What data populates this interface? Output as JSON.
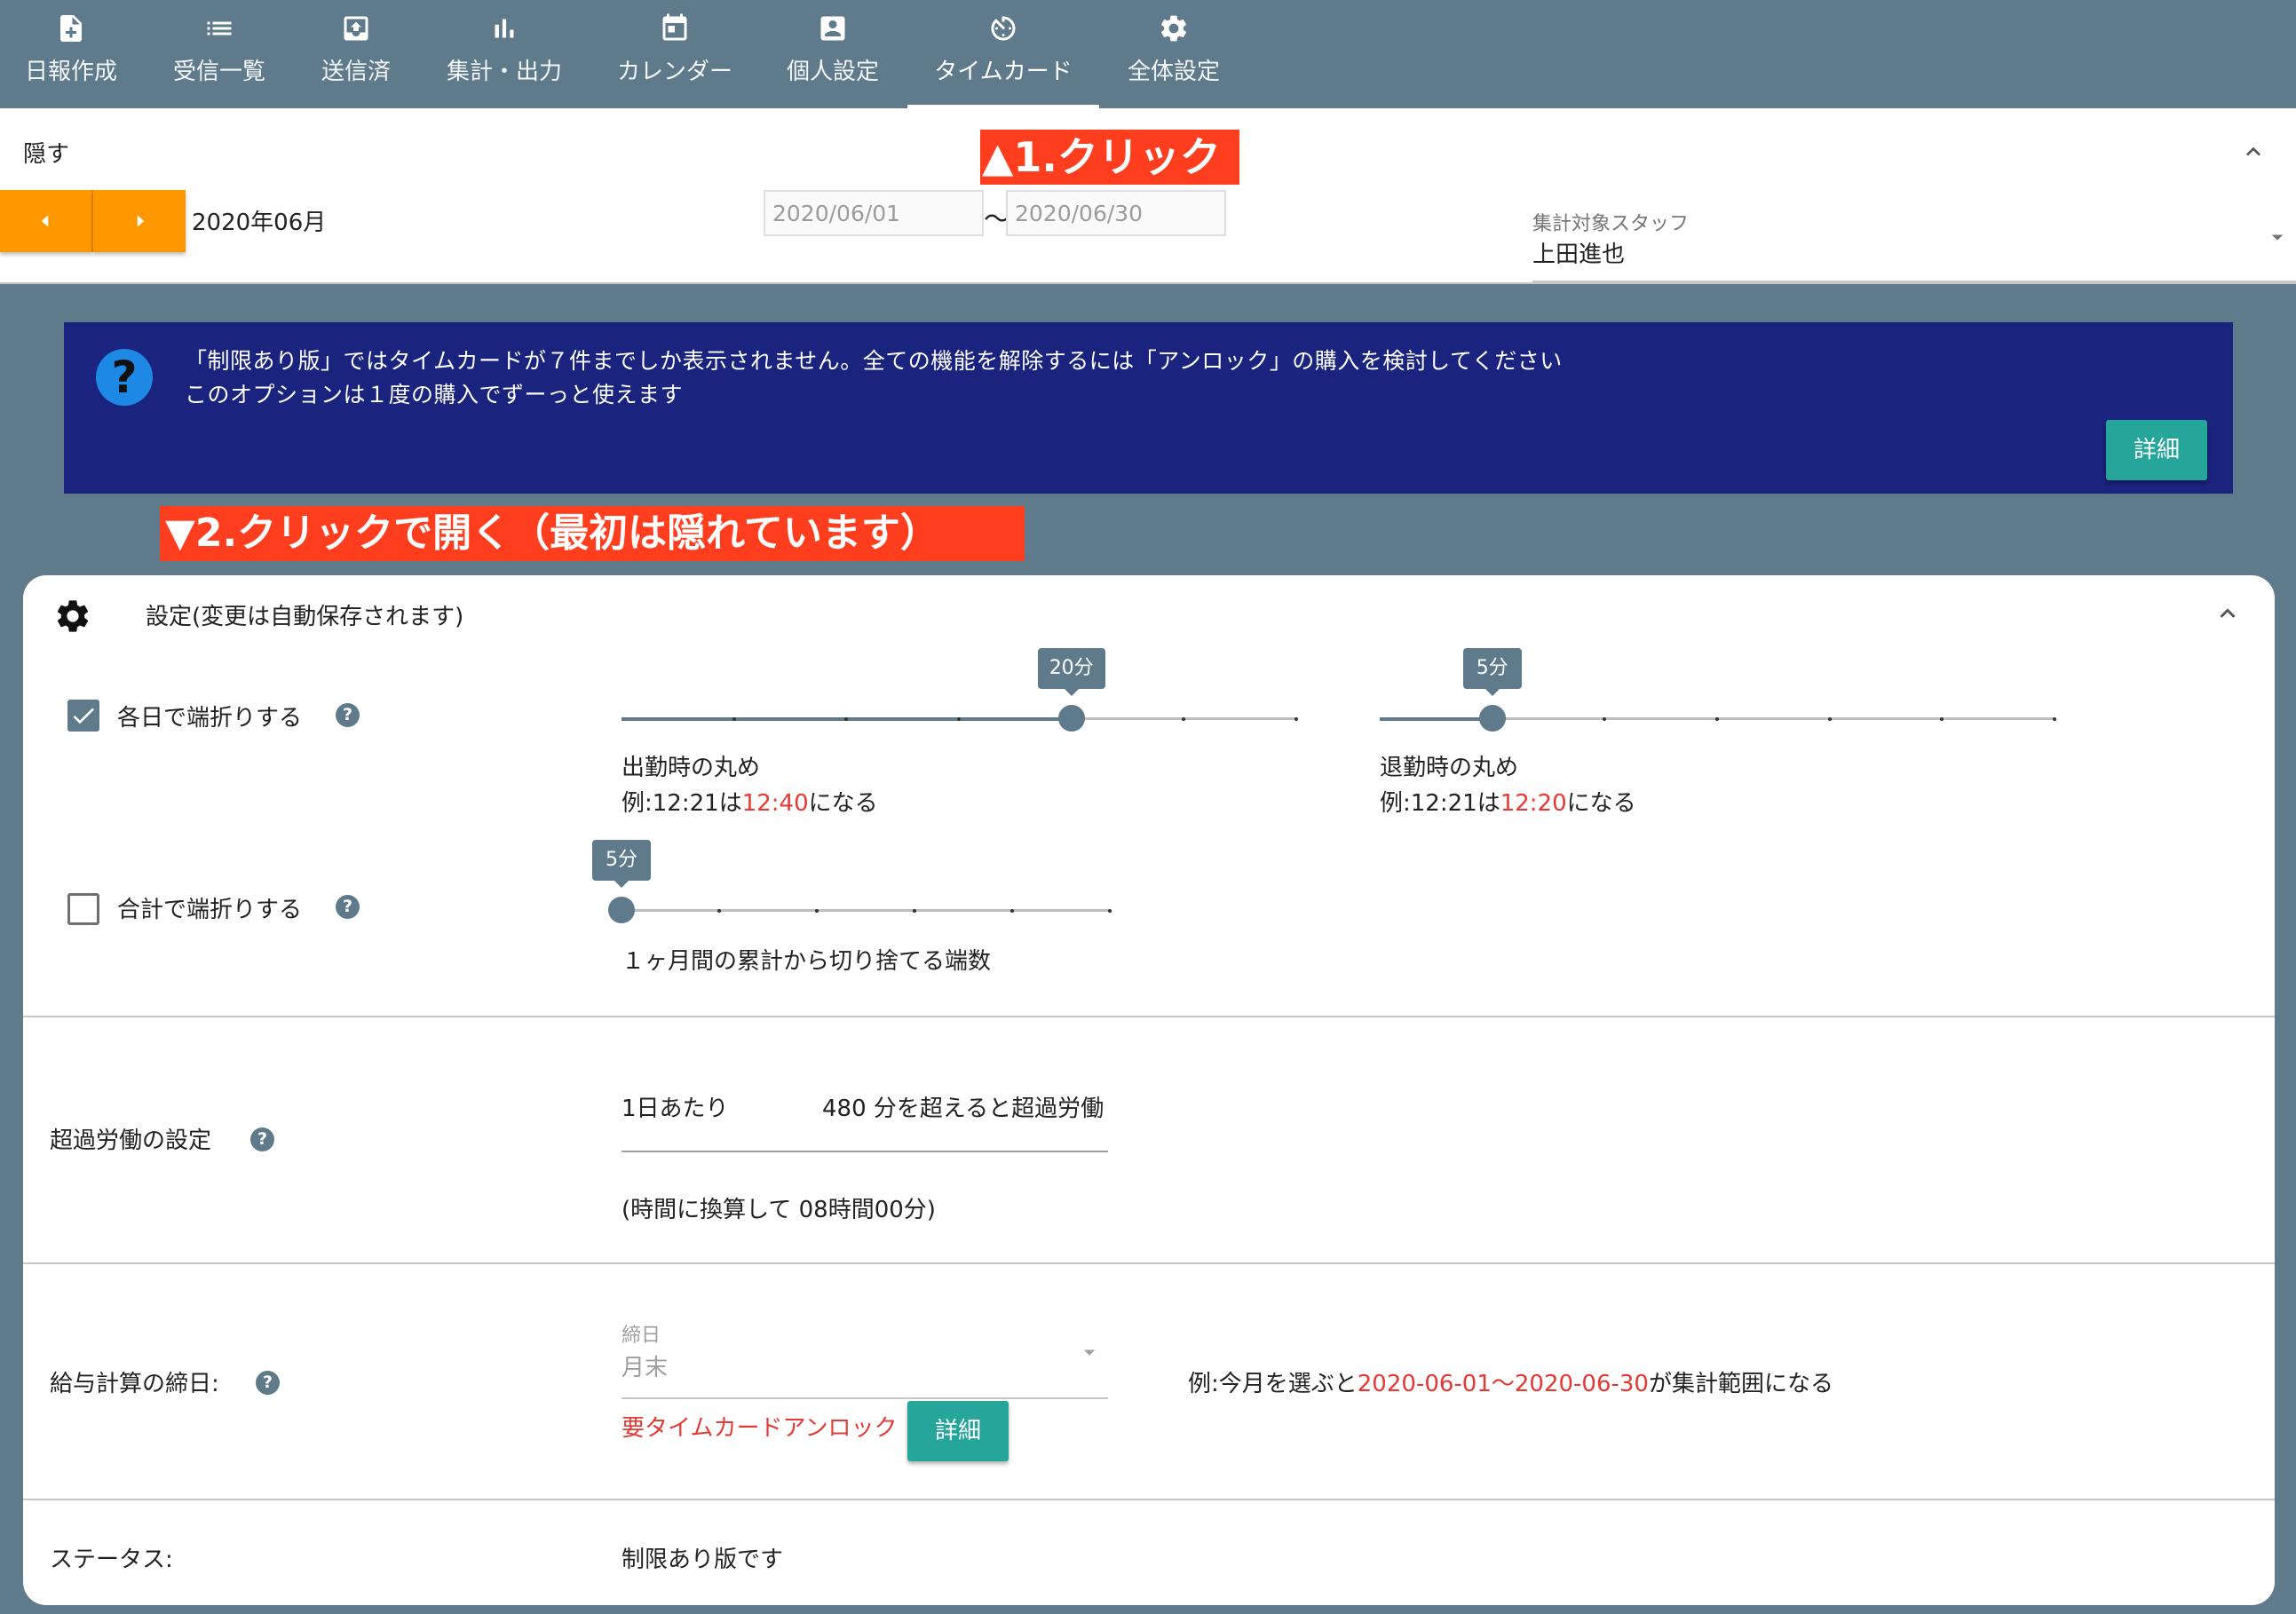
{
  "nav": {
    "items": [
      {
        "label": "日報作成",
        "icon": "file-plus-icon"
      },
      {
        "label": "受信一覧",
        "icon": "list-icon"
      },
      {
        "label": "送信済",
        "icon": "outbox-icon"
      },
      {
        "label": "集計・出力",
        "icon": "bar-chart-icon"
      },
      {
        "label": "カレンダー",
        "icon": "calendar-icon"
      },
      {
        "label": "個人設定",
        "icon": "account-box-icon"
      },
      {
        "label": "タイムカード",
        "icon": "timer-icon",
        "active": true
      },
      {
        "label": "全体設定",
        "icon": "gear-icon"
      }
    ]
  },
  "header": {
    "hide_label": "隠す",
    "month": "2020年06月",
    "date_from": "2020/06/01",
    "range_sep": "〜",
    "date_to": "2020/06/30",
    "staff_label": "集計対象スタッフ",
    "staff_value": "上田進也"
  },
  "callouts": {
    "first": "▲1.クリック",
    "second": "▼2.クリックで開く（最初は隠れています）"
  },
  "banner": {
    "line1": "「制限あり版」ではタイムカードが７件までしか表示されません。全ての機能を解除するには「アンロック」の購入を検討してください",
    "line2": "このオプションは１度の購入でずーっと使えます",
    "button": "詳細",
    "icon": "?"
  },
  "settings": {
    "title": "設定(変更は自動保存されます)",
    "help_glyph": "?",
    "daily_round": {
      "label": "各日で端折りする",
      "checked": true,
      "in": {
        "value_label": "20分",
        "title": "出勤時の丸め",
        "example_prefix": "例:12:21は",
        "example_value": "12:40",
        "example_suffix": "になる",
        "position": 0.6667
      },
      "out": {
        "value_label": "5分",
        "title": "退勤時の丸め",
        "example_prefix": "例:12:21は",
        "example_value": "12:20",
        "example_suffix": "になる",
        "position": 0.1667
      }
    },
    "total_round": {
      "label": "合計で端折りする",
      "checked": false,
      "value_label": "5分",
      "description": "１ヶ月間の累計から切り捨てる端数",
      "position": 0
    },
    "overtime": {
      "label": "超過労働の設定",
      "per_day": "1日あたり",
      "threshold": "480 分を超えると超過労働",
      "converted": "(時間に換算して 08時間00分)"
    },
    "payroll": {
      "label": "給与計算の締日:",
      "select_label": "締日",
      "select_value": "月末",
      "unlock_note": "要タイムカードアンロック",
      "button": "詳細",
      "example_prefix": "例:今月を選ぶと",
      "example_value": "2020-06-01〜2020-06-30",
      "example_suffix": "が集計範囲になる"
    },
    "status": {
      "label": "ステータス:",
      "value": "制限あり版です"
    }
  },
  "colors": {
    "nav_bg": "#5f7a8a",
    "banner_bg": "#1a237e",
    "accent_orange": "#ff9800",
    "teal_button": "#26a69a",
    "callout_red": "#ff3d1f",
    "example_red": "#e53935"
  }
}
